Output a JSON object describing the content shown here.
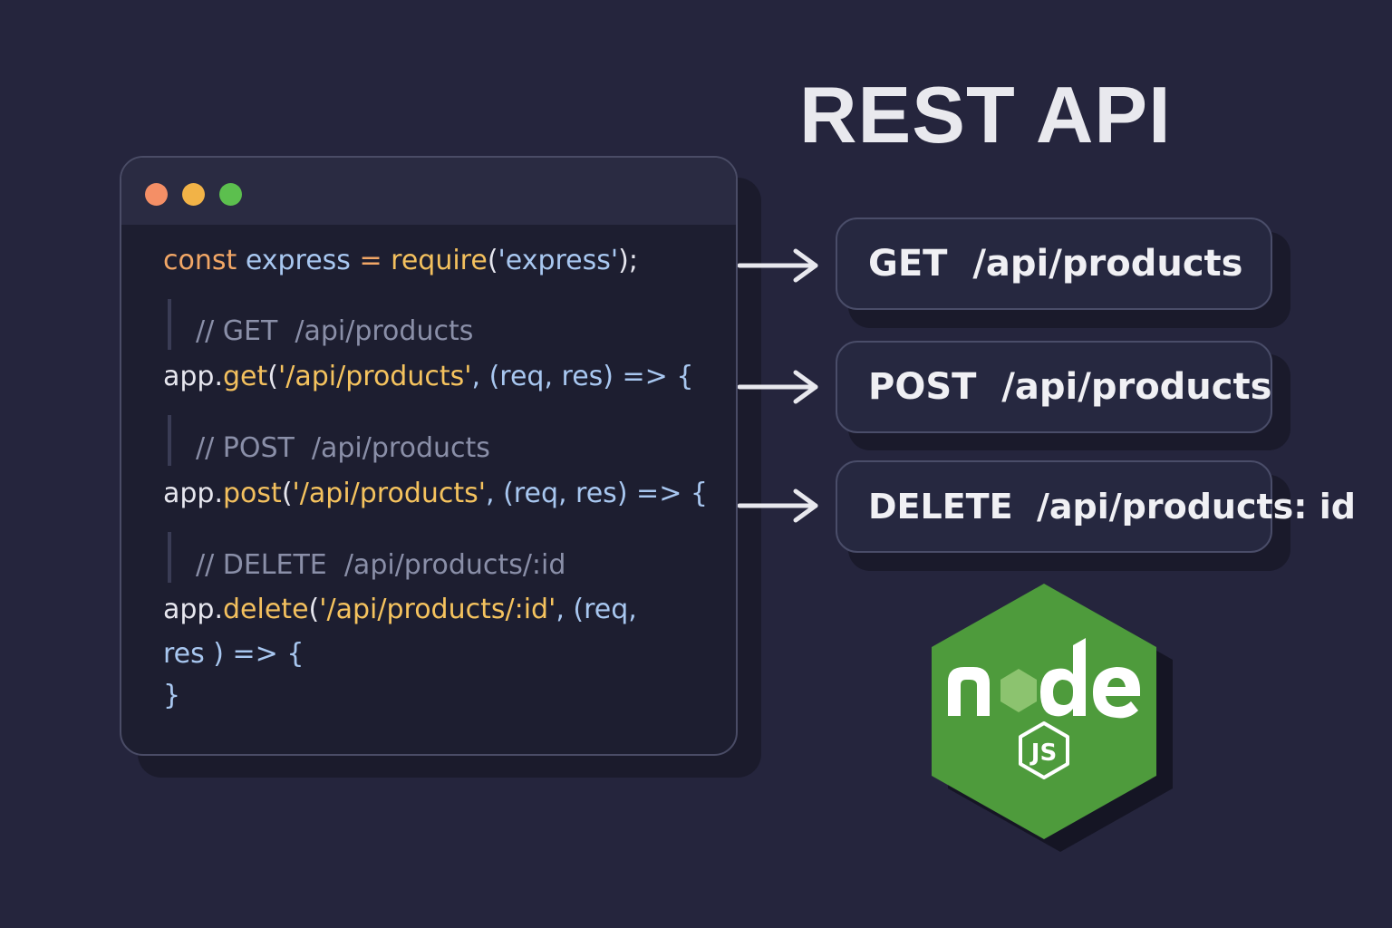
{
  "title": "REST API",
  "window": {
    "dots": [
      "#f48f66",
      "#f2b347",
      "#5cbf4e"
    ]
  },
  "code": {
    "line1": {
      "kw": "const",
      "ident": "express",
      "op": " = ",
      "fn": "require",
      "open": "(",
      "str": "'express'",
      "close": ");"
    },
    "comment_get": "// GET  /api/products",
    "line_get": {
      "obj": "app.",
      "fn": "get",
      "open": "(",
      "str": "'/api/products'",
      "rest": ", (req, res) => {"
    },
    "comment_post": "// POST  /api/products",
    "line_post": {
      "obj": "app.",
      "fn": "post",
      "open": "(",
      "str": "'/api/products'",
      "rest": ", (req, res) => {"
    },
    "comment_delete": "// DELETE  /api/products/:id",
    "line_delete": {
      "obj": "app.",
      "fn": "delete",
      "open": "(",
      "str": "'/api/products/:id'",
      "rest": ", (req,"
    },
    "line_delete2": "res ) => {",
    "closing": "}"
  },
  "routes": [
    {
      "method": "GET",
      "path": "/api/products"
    },
    {
      "method": "POST",
      "path": "/api/products"
    },
    {
      "method": "DELETE",
      "path": "/api/products: id"
    }
  ],
  "logo": {
    "word": "node",
    "sub": "JS",
    "color": "#4e9b3c",
    "accent": "#8cc36f"
  }
}
